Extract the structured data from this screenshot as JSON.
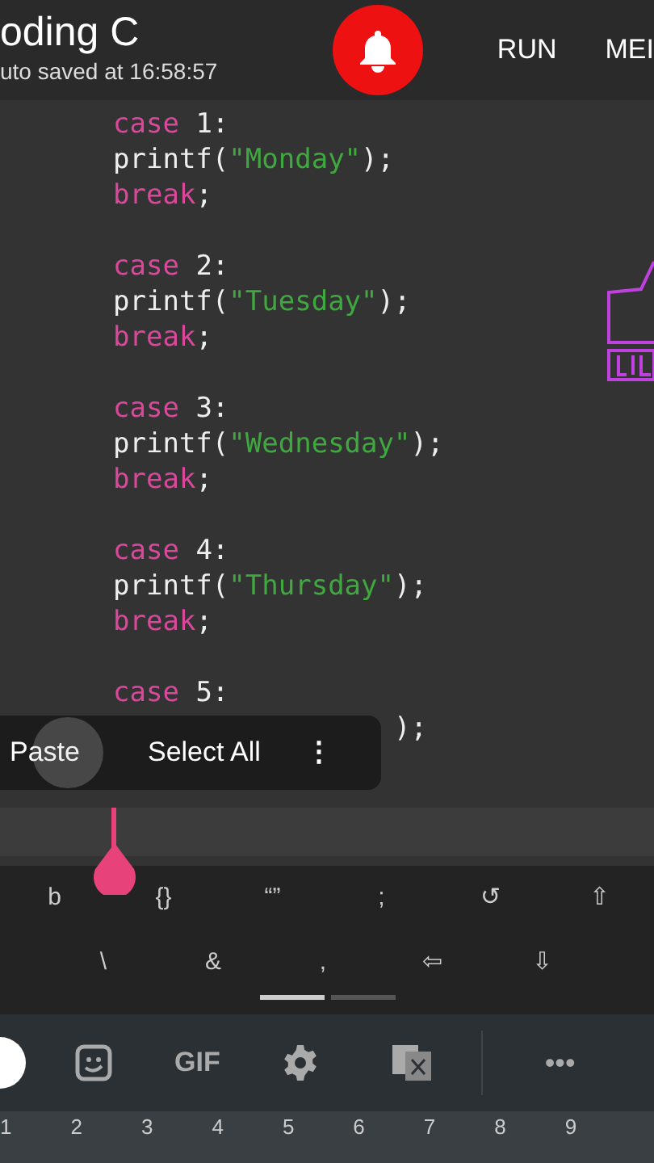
{
  "header": {
    "title": "oding C",
    "subtitle": "uto saved at 16:58:57",
    "notification": {
      "on": true
    },
    "actions": [
      "RUN",
      "MEI"
    ]
  },
  "code": [
    {
      "lines": [
        [
          {
            "kind": "keyword",
            "text": "case"
          },
          {
            "kind": "plain",
            "text": " 1:"
          }
        ],
        [
          {
            "kind": "plain",
            "text": "printf("
          },
          {
            "kind": "string",
            "text": "\"Monday\""
          },
          {
            "kind": "plain",
            "text": ");"
          }
        ],
        [
          {
            "kind": "keyword",
            "text": "break"
          },
          {
            "kind": "plain",
            "text": ";"
          }
        ]
      ]
    },
    {
      "lines": [
        [
          {
            "kind": "keyword",
            "text": "case"
          },
          {
            "kind": "plain",
            "text": " 2:"
          }
        ],
        [
          {
            "kind": "plain",
            "text": "printf("
          },
          {
            "kind": "string",
            "text": "\"Tuesday\""
          },
          {
            "kind": "plain",
            "text": ");"
          }
        ],
        [
          {
            "kind": "keyword",
            "text": "break"
          },
          {
            "kind": "plain",
            "text": ";"
          }
        ]
      ]
    },
    {
      "lines": [
        [
          {
            "kind": "keyword",
            "text": "case"
          },
          {
            "kind": "plain",
            "text": " 3:"
          }
        ],
        [
          {
            "kind": "plain",
            "text": "printf("
          },
          {
            "kind": "string",
            "text": "\"Wednesday\""
          },
          {
            "kind": "plain",
            "text": ");"
          }
        ],
        [
          {
            "kind": "keyword",
            "text": "break"
          },
          {
            "kind": "plain",
            "text": ";"
          }
        ]
      ]
    },
    {
      "lines": [
        [
          {
            "kind": "keyword",
            "text": "case"
          },
          {
            "kind": "plain",
            "text": " 4:"
          }
        ],
        [
          {
            "kind": "plain",
            "text": "printf("
          },
          {
            "kind": "string",
            "text": "\"Thursday\""
          },
          {
            "kind": "plain",
            "text": ");"
          }
        ],
        [
          {
            "kind": "keyword",
            "text": "break"
          },
          {
            "kind": "plain",
            "text": ";"
          }
        ]
      ]
    },
    {
      "lines": [
        [
          {
            "kind": "keyword",
            "text": "case"
          },
          {
            "kind": "plain",
            "text": " 5:"
          }
        ],
        [
          {
            "kind": "plain",
            "text": "                 );"
          }
        ]
      ]
    }
  ],
  "context_menu": {
    "items": [
      "Paste",
      "Select All"
    ],
    "more": "⋮"
  },
  "symbol_keys": [
    [
      "b",
      "{}",
      "“”",
      ";",
      "↺",
      "⇧"
    ],
    [
      "\\",
      "&",
      ",",
      "⇦",
      "⇩"
    ]
  ],
  "symbol_pages": [
    {
      "selected": true
    },
    {
      "selected": false
    }
  ],
  "toolbar": {
    "gif": "GIF",
    "more": "•••"
  },
  "number_hints": [
    "1",
    "2",
    "3",
    "4",
    "5",
    "6",
    "7",
    "8",
    "9"
  ]
}
